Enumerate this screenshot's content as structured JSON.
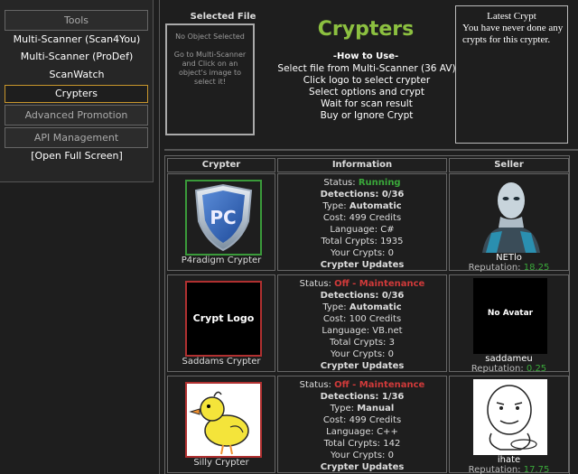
{
  "sidebar": {
    "tools_label": "Tools",
    "items": [
      {
        "label": "Multi-Scanner (Scan4You)"
      },
      {
        "label": "Multi-Scanner (ProDef)"
      },
      {
        "label": "ScanWatch"
      },
      {
        "label": "Crypters"
      },
      {
        "label": "Advanced Promotion System"
      },
      {
        "label": "API Management"
      },
      {
        "label": "[Open Full Screen]"
      }
    ]
  },
  "selected_file": {
    "title": "Selected File",
    "empty_text": "No Object Selected",
    "hint": "Go to Multi-Scanner and Click on an object's image to select it!"
  },
  "main": {
    "title": "Crypters",
    "howto_title": "-How to Use-",
    "howto_lines": [
      "Select file from Multi-Scanner (36 AV)",
      "Click logo to select crypter",
      "Select options and crypt",
      "Wait for scan result",
      "Buy or Ignore Crypt"
    ]
  },
  "latest": {
    "title": "Latest Crypt",
    "text": "You have never done any crypts for this crypter."
  },
  "table": {
    "headers": [
      "Crypter",
      "Information",
      "Seller"
    ],
    "labels": {
      "status": "Status: ",
      "detections": "Detections: ",
      "type": "Type: ",
      "cost": "Cost: ",
      "language": "Language: ",
      "total": "Total Crypts: ",
      "yours": "Your Crypts: ",
      "updates": "Crypter Updates",
      "reputation": "Reputation: "
    },
    "rows": [
      {
        "name": "P4radigm Crypter",
        "logo_text": "PC",
        "status": "Running",
        "detections": "0/36",
        "type": "Automatic",
        "cost": "499 Credits",
        "language": "C#",
        "total": "1935",
        "yours": "0",
        "seller": "NETlo",
        "reputation": "18.25"
      },
      {
        "name": "Saddams Crypter",
        "logo_text": "Crypt Logo",
        "status": "Off - Maintenance",
        "detections": "0/36",
        "type": "Automatic",
        "cost": "100 Credits",
        "language": "VB.net",
        "total": "3",
        "yours": "0",
        "seller": "saddameu",
        "avatar_text": "No Avatar",
        "reputation": "0.25"
      },
      {
        "name": "Silly Crypter",
        "status": "Off - Maintenance",
        "detections": "1/36",
        "type": "Manual",
        "cost": "499 Credits",
        "language": "C++",
        "total": "142",
        "yours": "0",
        "seller": "ihate",
        "reputation": "17.75"
      }
    ]
  },
  "colors": {
    "accent_green": "#8cc040",
    "running": "#3aa83a",
    "off": "#d03a3a",
    "active_border": "#c8962c"
  }
}
